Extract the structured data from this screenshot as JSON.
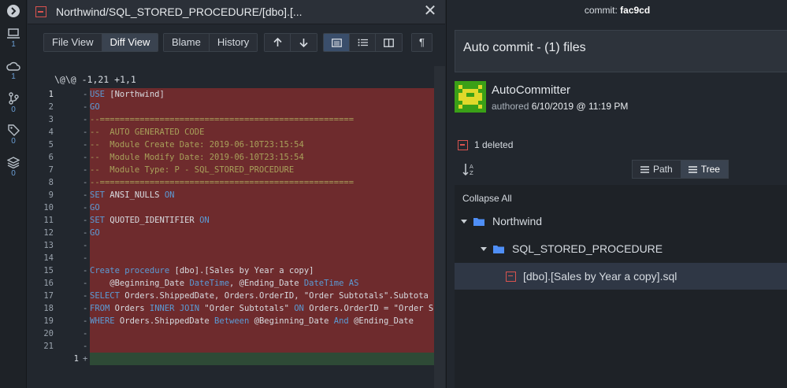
{
  "activity_bar": [
    {
      "icon": "chevron-right-icon"
    },
    {
      "icon": "computer-icon",
      "count": "1"
    },
    {
      "icon": "cloud-icon",
      "count": "1"
    },
    {
      "icon": "branch-icon",
      "count": "0"
    },
    {
      "icon": "tag-icon",
      "count": "0"
    },
    {
      "icon": "layers-icon",
      "count": "0"
    }
  ],
  "editor": {
    "tab_title": "Northwind/SQL_STORED_PROCEDURE/[dbo].[...",
    "close_glyph": "✕",
    "toolbar": {
      "file_view": "File View",
      "diff_view": "Diff View",
      "blame": "Blame",
      "history": "History",
      "pilcrow": "¶"
    },
    "hunk_header": "\\@\\@ -1,21 +1,1",
    "lines": [
      {
        "n": "1",
        "mark": "-",
        "text": "USE [Northwind]"
      },
      {
        "n": "2",
        "mark": "-",
        "text": "GO"
      },
      {
        "n": "3",
        "mark": "-",
        "text": "--==================================================="
      },
      {
        "n": "4",
        "mark": "-",
        "text": "--  AUTO GENERATED CODE"
      },
      {
        "n": "5",
        "mark": "-",
        "text": "--  Module Create Date: 2019-06-10T23:15:54"
      },
      {
        "n": "6",
        "mark": "-",
        "text": "--  Module Modify Date: 2019-06-10T23:15:54"
      },
      {
        "n": "7",
        "mark": "-",
        "text": "--  Module Type: P - SQL_STORED_PROCEDURE"
      },
      {
        "n": "8",
        "mark": "-",
        "text": "--==================================================="
      },
      {
        "n": "9",
        "mark": "-",
        "text": "SET ANSI_NULLS ON"
      },
      {
        "n": "10",
        "mark": "-",
        "text": "GO"
      },
      {
        "n": "11",
        "mark": "-",
        "text": "SET QUOTED_IDENTIFIER ON"
      },
      {
        "n": "12",
        "mark": "-",
        "text": "GO"
      },
      {
        "n": "13",
        "mark": "-",
        "text": ""
      },
      {
        "n": "14",
        "mark": "-",
        "text": ""
      },
      {
        "n": "15",
        "mark": "-",
        "text": "Create procedure [dbo].[Sales by Year a copy]"
      },
      {
        "n": "16",
        "mark": "-",
        "text": "    @Beginning_Date DateTime, @Ending_Date DateTime AS"
      },
      {
        "n": "17",
        "mark": "-",
        "text": "SELECT Orders.ShippedDate, Orders.OrderID, \"Order Subtotals\".Subtota"
      },
      {
        "n": "18",
        "mark": "-",
        "text": "FROM Orders INNER JOIN \"Order Subtotals\" ON Orders.OrderID = \"Order S"
      },
      {
        "n": "19",
        "mark": "-",
        "text": "WHERE Orders.ShippedDate Between @Beginning_Date And @Ending_Date"
      },
      {
        "n": "20",
        "mark": "-",
        "text": ""
      },
      {
        "n": "21",
        "mark": "-",
        "text": ""
      }
    ],
    "added_line": {
      "n": "1",
      "mark": "+",
      "text": ""
    }
  },
  "commit": {
    "label": "commit:",
    "sha": "fac9cd",
    "message": "Auto commit - (1) files",
    "author": "AutoCommitter",
    "authored_label": "authored",
    "date": "6/10/2019 @ 11:19 PM",
    "deleted_summary": "1 deleted",
    "view_path": "Path",
    "view_tree": "Tree",
    "collapse_all": "Collapse All",
    "tree": {
      "root": "Northwind",
      "folder": "SQL_STORED_PROCEDURE",
      "file": "[dbo].[Sales by Year a copy].sql"
    }
  },
  "colors": {
    "deleted_bg": "#6e2b2d",
    "added_bg": "#2e4a36",
    "accent_blue": "#5b9bd5",
    "delete_red": "#d9534f",
    "avatar_green": "#3aa017",
    "avatar_yellow": "#e0d92a"
  }
}
